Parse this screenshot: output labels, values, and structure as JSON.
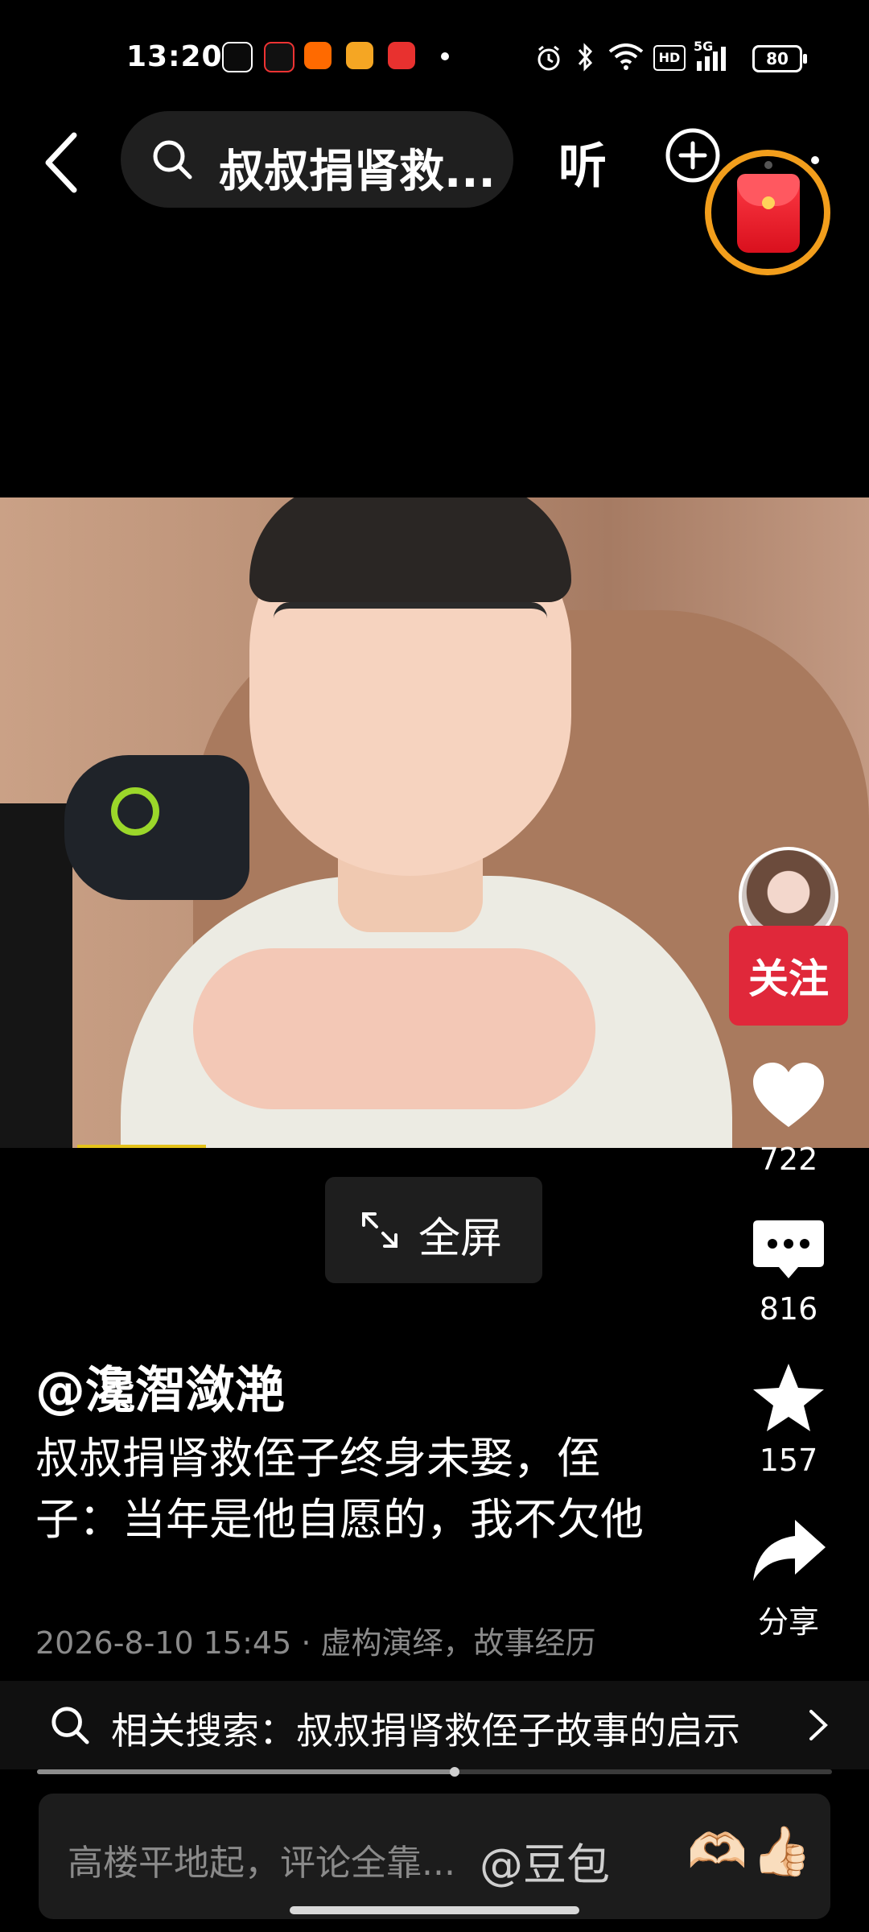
{
  "status_bar": {
    "time": "13:20",
    "app_icons": [
      "wechat-icon",
      "tiktok-icon",
      "taobao-icon",
      "video-app-icon",
      "game-app-icon"
    ],
    "battery": "80",
    "network": "5G",
    "hd_label": "HD"
  },
  "top_bar": {
    "search_query": "叔叔捐肾救...",
    "listen_label": "听"
  },
  "video": {
    "fullscreen_label": "全屏"
  },
  "actions": {
    "follow_label": "关注",
    "likes": "722",
    "comments": "816",
    "favorites": "157",
    "share_label": "分享"
  },
  "post": {
    "author": "@瀺潪潋滟",
    "description": "叔叔捐肾救侄子终身未娶，侄子：当年是他自愿的，我不欠他",
    "meta": "2026-8-10 15:45 · 虚构演绎，故事经历"
  },
  "related": {
    "text": "相关搜索：叔叔捐肾救侄子故事的启示"
  },
  "progress": 0.525,
  "comment_bar": {
    "placeholder": "高楼平地起，评论全靠...",
    "mention": "@豆包",
    "emoji_1": "🫶🏻",
    "emoji_2": "👍🏻"
  },
  "colors": {
    "follow_red": "#e0283a",
    "redpacket_ring": "#f29e1c"
  }
}
